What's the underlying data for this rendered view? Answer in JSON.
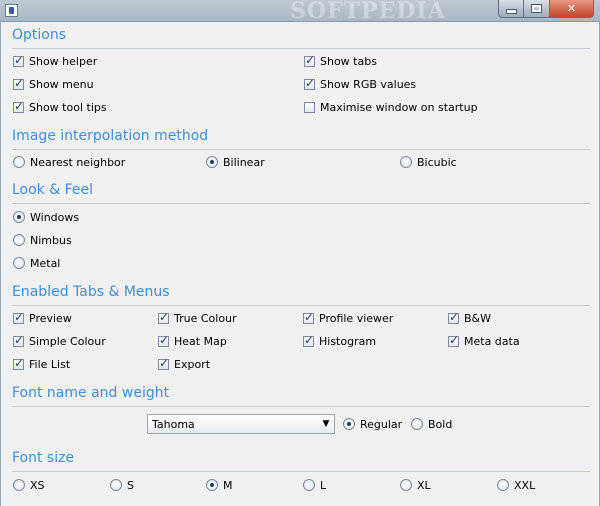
{
  "window": {
    "watermark": "SOFTPEDIA",
    "close_glyph": "✕"
  },
  "options": {
    "title": "Options",
    "items": [
      {
        "label": "Show helper",
        "checked": true
      },
      {
        "label": "Show menu",
        "checked": true
      },
      {
        "label": "Show tool tips",
        "checked": true
      },
      {
        "label": "Show tabs",
        "checked": true
      },
      {
        "label": "Show RGB values",
        "checked": true
      },
      {
        "label": "Maximise window on startup",
        "checked": false
      }
    ]
  },
  "interpolation": {
    "title": "Image interpolation method",
    "items": [
      {
        "label": "Nearest neighbor",
        "selected": false
      },
      {
        "label": "Bilinear",
        "selected": true
      },
      {
        "label": "Bicubic",
        "selected": false
      }
    ]
  },
  "look": {
    "title": "Look & Feel",
    "items": [
      {
        "label": "Windows",
        "selected": true
      },
      {
        "label": "Nimbus",
        "selected": false
      },
      {
        "label": "Metal",
        "selected": false
      }
    ]
  },
  "tabs": {
    "title": "Enabled Tabs & Menus",
    "items": [
      {
        "label": "Preview",
        "checked": true
      },
      {
        "label": "Simple Colour",
        "checked": true
      },
      {
        "label": "File List",
        "checked": true
      },
      {
        "label": "True Colour",
        "checked": true
      },
      {
        "label": "Heat Map",
        "checked": true
      },
      {
        "label": "Export",
        "checked": true
      },
      {
        "label": "Profile viewer",
        "checked": true
      },
      {
        "label": "Histogram",
        "checked": true
      },
      {
        "label": "B&W",
        "checked": true
      },
      {
        "label": "Meta data",
        "checked": true
      }
    ]
  },
  "font": {
    "title": "Font name and weight",
    "name": "Tahoma",
    "weights": [
      {
        "label": "Regular",
        "selected": true
      },
      {
        "label": "Bold",
        "selected": false
      }
    ]
  },
  "font_size": {
    "title": "Font size",
    "items": [
      {
        "label": "XS",
        "selected": false
      },
      {
        "label": "S",
        "selected": false
      },
      {
        "label": "M",
        "selected": true
      },
      {
        "label": "L",
        "selected": false
      },
      {
        "label": "XL",
        "selected": false
      },
      {
        "label": "XXL",
        "selected": false
      }
    ]
  }
}
